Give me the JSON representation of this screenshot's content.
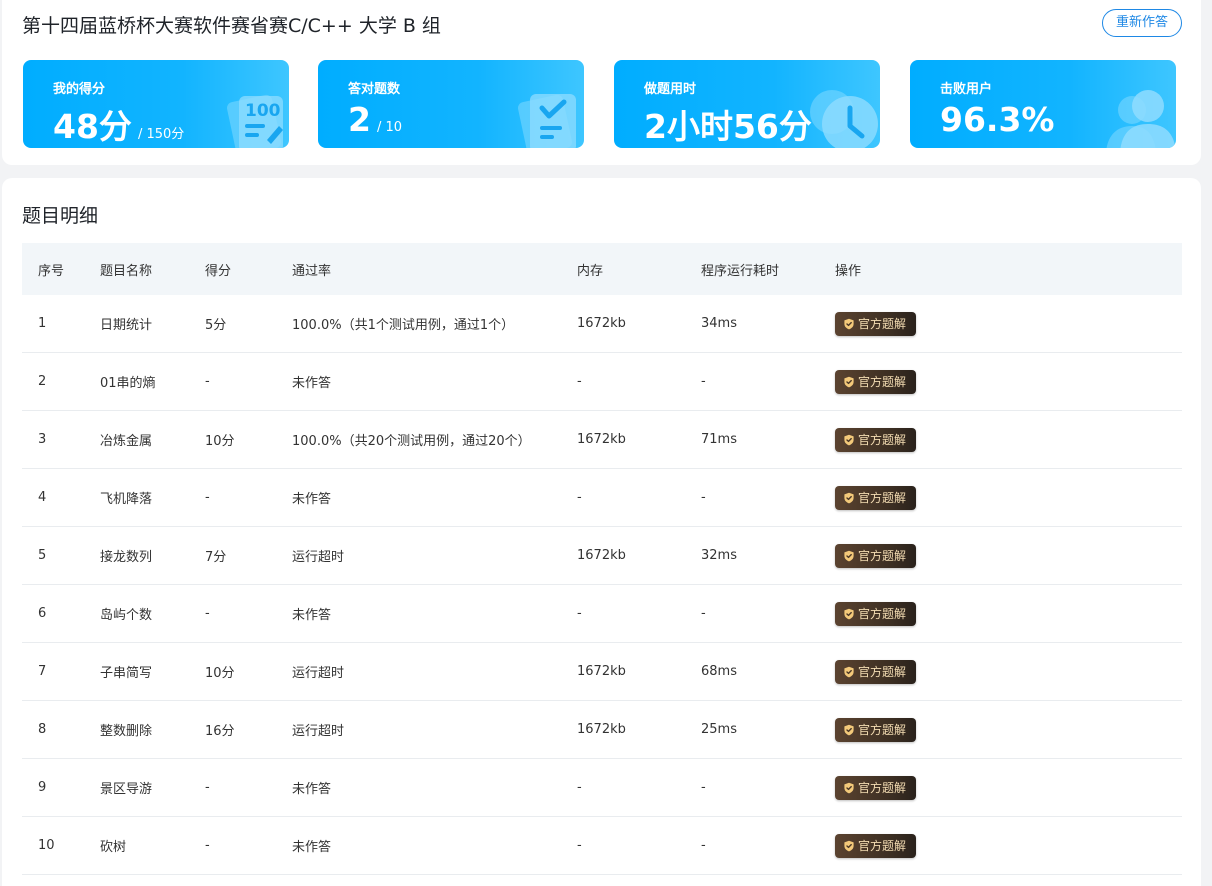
{
  "header": {
    "title": "第十四届蓝桥杯大赛软件赛省赛C/C++ 大学 B 组",
    "retry_label": "重新作答"
  },
  "stats": [
    {
      "label": "我的得分",
      "value": "48分",
      "sub": "/ 150分"
    },
    {
      "label": "答对题数",
      "value": "2",
      "sub": "/ 10"
    },
    {
      "label": "做题用时",
      "value": "2小时56分",
      "sub": ""
    },
    {
      "label": "击败用户",
      "value": "96.3%",
      "sub": ""
    }
  ],
  "detail": {
    "title": "题目明细",
    "columns": [
      "序号",
      "题目名称",
      "得分",
      "通过率",
      "内存",
      "程序运行耗时",
      "操作"
    ],
    "solution_label": "官方题解",
    "rows": [
      {
        "no": "1",
        "name": "日期统计",
        "score": "5分",
        "pass": "100.0%（共1个测试用例，通过1个）",
        "mem": "1672kb",
        "time": "34ms"
      },
      {
        "no": "2",
        "name": "01串的熵",
        "score": "-",
        "pass": "未作答",
        "mem": "-",
        "time": "-"
      },
      {
        "no": "3",
        "name": "冶炼金属",
        "score": "10分",
        "pass": "100.0%（共20个测试用例，通过20个）",
        "mem": "1672kb",
        "time": "71ms"
      },
      {
        "no": "4",
        "name": "飞机降落",
        "score": "-",
        "pass": "未作答",
        "mem": "-",
        "time": "-"
      },
      {
        "no": "5",
        "name": "接龙数列",
        "score": "7分",
        "pass": "运行超时",
        "mem": "1672kb",
        "time": "32ms"
      },
      {
        "no": "6",
        "name": "岛屿个数",
        "score": "-",
        "pass": "未作答",
        "mem": "-",
        "time": "-"
      },
      {
        "no": "7",
        "name": "子串简写",
        "score": "10分",
        "pass": "运行超时",
        "mem": "1672kb",
        "time": "68ms"
      },
      {
        "no": "8",
        "name": "整数删除",
        "score": "16分",
        "pass": "运行超时",
        "mem": "1672kb",
        "time": "25ms"
      },
      {
        "no": "9",
        "name": "景区导游",
        "score": "-",
        "pass": "未作答",
        "mem": "-",
        "time": "-"
      },
      {
        "no": "10",
        "name": "砍树",
        "score": "-",
        "pass": "未作答",
        "mem": "-",
        "time": "-"
      }
    ]
  }
}
